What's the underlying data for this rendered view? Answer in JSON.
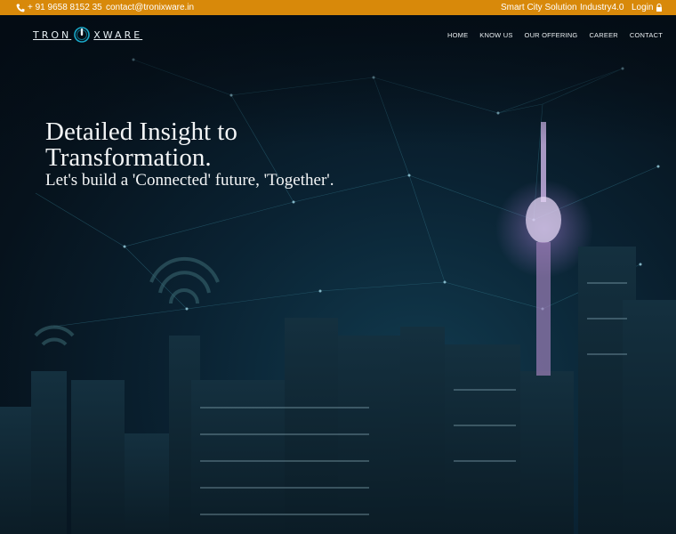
{
  "topbar": {
    "phone": "+ 91 9658 8152 35",
    "email": "contact@tronixware.in",
    "links": [
      "Smart City Solution",
      "Industry4.0",
      "Login"
    ],
    "background": "#d8890a"
  },
  "brand": {
    "name_left": "TRON",
    "name_right": "XWARE",
    "logo_icon": "power-icon"
  },
  "nav": {
    "items": [
      "HOME",
      "KNOW US",
      "OUR OFFERING",
      "CAREER",
      "CONTACT"
    ]
  },
  "hero": {
    "headline_line1": "Detailed Insight to",
    "headline_line2": "Transformation.",
    "subheadline": "Let's build a 'Connected' future, 'Together'."
  }
}
